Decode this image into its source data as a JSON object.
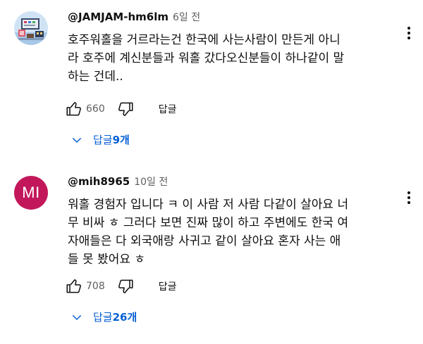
{
  "comments": [
    {
      "author": "@JAMJAM-hm6lm",
      "time": "6일 전",
      "text": "호주워홀을 거르라는건 한국에 사는사람이 만든게 아니\n라 호주에 계신분들과 워홀 갔다오신분들이 하나같이 말\n하는 건데..",
      "likes": "660",
      "reply_label": "답글",
      "replies_prefix": "답글 ",
      "replies_count": "9개",
      "avatar_icon": "pixel-art-avatar-icon"
    },
    {
      "author": "@mih8965",
      "time": "10일 전",
      "text": "워홀 경험자 입니다 ㅋ 이 사람 저 사람 다같이 살아요 너\n무 비싸 ㅎ 그러다 보면 진짜 많이 하고 주변에도 한국 여\n자애들은 다 외국애랑 사귀고 같이 살아요 혼자 사는 애\n들 못 봤어요 ㅎ",
      "likes": "708",
      "reply_label": "답글",
      "replies_prefix": "답글 ",
      "replies_count": "26개",
      "avatar_initials": "MI",
      "avatar_color": "#c2185b"
    }
  ],
  "colors": {
    "link": "#065fd4",
    "secondary_text": "#606060",
    "primary_text": "#0f0f0f"
  }
}
